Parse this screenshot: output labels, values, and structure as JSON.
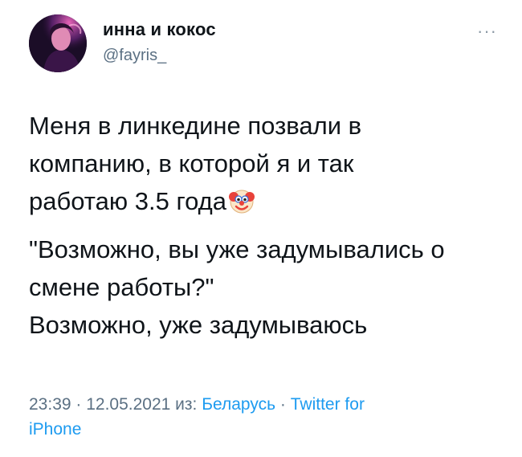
{
  "author": {
    "display_name": "инна и кокос",
    "handle": "@fayris_",
    "avatar_icon": "profile-photo"
  },
  "more_label": "···",
  "body": {
    "para1": [
      "Меня в линкедине позвали в",
      "компанию, в которой я и так",
      "работаю 3.5 года"
    ],
    "para1_emoji": "clown-face",
    "para2": [
      "\"Возможно, вы уже задумывались о",
      "смене работы?\"",
      "Возможно, уже задумываюсь"
    ]
  },
  "meta": {
    "time": "23:39",
    "dot1": " · ",
    "date": "12.05.2021",
    "from_label": " из: ",
    "location": "Беларусь",
    "dot2": " · ",
    "source_line1": "Twitter for",
    "source_line2": "iPhone"
  },
  "colors": {
    "text": "#0f1419",
    "secondary": "#5b7083",
    "link": "#1d9bf0"
  }
}
